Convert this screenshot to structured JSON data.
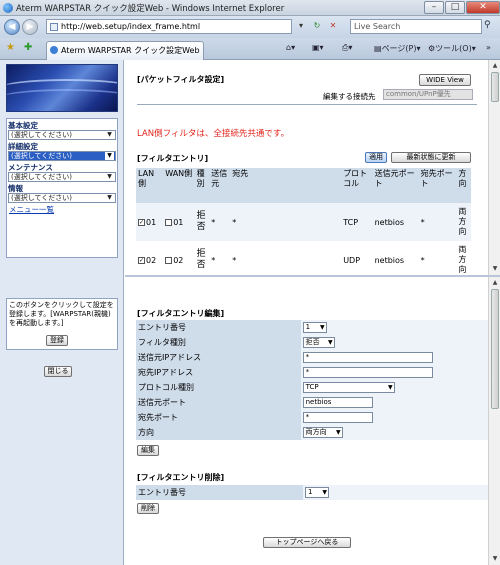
{
  "window": {
    "title": "Aterm WARPSTAR クイック設定Web - Windows Internet Explorer"
  },
  "address": {
    "url": "http://web.setup/index_frame.html",
    "search_placeholder": "Live Search"
  },
  "tab": {
    "label": "Aterm WARPSTAR クイック設定Web"
  },
  "toolbar": {
    "page_label": "ページ(P)",
    "tools_label": "ツール(O)"
  },
  "sidebar": {
    "menus": [
      {
        "label": "基本設定",
        "value": "(選択してください)"
      },
      {
        "label": "詳細設定",
        "value": "(選択してください)"
      },
      {
        "label": "メンテナンス",
        "value": "(選択してください)"
      },
      {
        "label": "情報",
        "value": "(選択してください)"
      }
    ],
    "menu_list_link": "メニュー一覧",
    "register_note": "このボタンをクリックして設定を登録します。[WARPSTAR(親機)を再起動します。]",
    "register_button": "登録",
    "close_button": "閉じる"
  },
  "upper": {
    "title": "[パケットフィルタ設定]",
    "wide_view": "WIDE View",
    "connection_label": "編集する接続先",
    "connection_value": "common/UPnP優先",
    "notice": "LAN側フィルタは、全接続先共通です。",
    "entry_title": "[フィルタエントリ]",
    "apply_button": "適用",
    "refresh_button": "最新状態に更新",
    "columns": [
      "LAN側",
      "WAN側",
      "種別",
      "送信元",
      "宛先",
      "プロトコル",
      "送信元ポート",
      "宛先ポート",
      "方向"
    ],
    "rows": [
      {
        "lan": "01",
        "wan": "01",
        "type": "拒否",
        "src": "*",
        "dst": "*",
        "proto": "TCP",
        "sport": "netbios",
        "dport": "*",
        "dir": "両方向"
      },
      {
        "lan": "02",
        "wan": "02",
        "type": "拒否",
        "src": "*",
        "dst": "*",
        "proto": "UDP",
        "sport": "netbios",
        "dport": "*",
        "dir": "両方向"
      }
    ]
  },
  "lower": {
    "edit_title": "[フィルタエントリ編集]",
    "fields": {
      "entry_no": {
        "label": "エントリ番号",
        "value": "1"
      },
      "filter_type": {
        "label": "フィルタ種別",
        "value": "拒否"
      },
      "src_ip": {
        "label": "送信元IPアドレス",
        "value": "*"
      },
      "dst_ip": {
        "label": "宛先IPアドレス",
        "value": "*"
      },
      "protocol": {
        "label": "プロトコル種別",
        "value": "TCP"
      },
      "src_port": {
        "label": "送信元ポート",
        "value": "netbios"
      },
      "dst_port": {
        "label": "宛先ポート",
        "value": "*"
      },
      "direction": {
        "label": "方向",
        "value": "両方向"
      }
    },
    "edit_button": "編集",
    "delete_title": "[フィルタエントリ削除]",
    "delete_entry": {
      "label": "エントリ番号",
      "value": "1"
    },
    "delete_button": "削除",
    "top_button": "トップページへ戻る"
  }
}
